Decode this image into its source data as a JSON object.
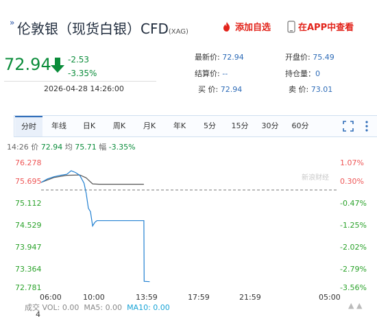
{
  "header": {
    "title": "伦敦银（现货白银）CFD",
    "code": "(XAG)",
    "add_fav": "添加自选",
    "app_view": "在APP中查看"
  },
  "quote": {
    "price": "72.94",
    "change": "-2.53",
    "change_pct": "-3.35%",
    "datetime": "2026-04-28 14:26:00"
  },
  "stats": {
    "latest_label": "最新价:",
    "latest_value": "72.94",
    "open_label": "开盘价:",
    "open_value": "75.49",
    "settle_label": "结算价:",
    "settle_value": "--",
    "oi_label": "持仓量：",
    "oi_value": "0",
    "buy_label": "买  价:",
    "buy_value": "72.94",
    "sell_label": "卖  价:",
    "sell_value": "73.01"
  },
  "tabs": [
    "分时",
    "年线",
    "日K",
    "周K",
    "月K",
    "年K",
    "5分",
    "15分",
    "30分",
    "60分"
  ],
  "status": {
    "time": "14:26",
    "price_label": "价",
    "price": "72.94",
    "avg_label": "均",
    "avg": "75.71",
    "pct_label": "幅",
    "pct": "-3.35%"
  },
  "watermark": "新浪财经",
  "colors": {
    "up": "#e55555",
    "down": "#2aa22a",
    "price_line": "#1f7fd1",
    "avg_line": "#555555",
    "accent": "#2d6bb7"
  },
  "chart_data": {
    "type": "line",
    "y_ticks": [
      "76.278",
      "75.695",
      "75.112",
      "74.529",
      "73.947",
      "73.364",
      "72.781"
    ],
    "y_ticks_pct": [
      "1.07%",
      "0.30%",
      "-0.47%",
      "-1.25%",
      "-2.02%",
      "-2.79%",
      "-3.56%"
    ],
    "prev_close": 75.47,
    "x_ticks": [
      "06:00",
      "10:00",
      "13:59",
      "17:59",
      "21:59",
      "05:00"
    ],
    "series": [
      {
        "x": [
          "06:00",
          "06:30",
          "07:00",
          "07:30",
          "08:00",
          "08:20",
          "08:40",
          "09:00",
          "09:20",
          "09:30",
          "09:40",
          "09:50",
          "10:00",
          "10:10",
          "10:20",
          "11:00",
          "12:00",
          "13:00",
          "13:50",
          "13:59",
          "14:00",
          "14:26"
        ],
        "values": [
          75.72,
          75.82,
          75.88,
          75.92,
          75.95,
          76.05,
          76.0,
          75.92,
          75.7,
          75.42,
          75.0,
          74.9,
          74.5,
          74.6,
          74.65,
          74.65,
          74.65,
          74.65,
          74.65,
          74.65,
          72.95,
          72.94
        ]
      },
      {
        "x": [
          "06:00",
          "07:00",
          "08:00",
          "09:00",
          "09:30",
          "10:00",
          "10:30",
          "12:00",
          "13:00",
          "13:59"
        ],
        "values": [
          75.72,
          75.86,
          75.92,
          75.93,
          75.85,
          75.68,
          75.67,
          75.67,
          75.67,
          75.67
        ]
      }
    ]
  },
  "volume": {
    "label": "成交",
    "vol_label": "VOL:",
    "vol": "0.00",
    "ma5_label": "MA5:",
    "ma5": "0.00",
    "ma10_label": "MA10:",
    "ma10": "0.00",
    "count": "4"
  }
}
